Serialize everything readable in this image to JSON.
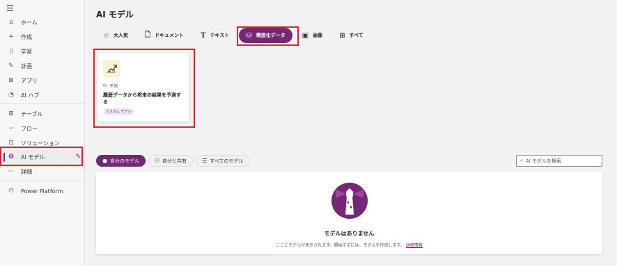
{
  "sidebar": {
    "items": [
      {
        "label": "ホーム",
        "icon": "home-icon"
      },
      {
        "label": "作成",
        "icon": "plus-icon"
      },
      {
        "label": "学習",
        "icon": "book-icon"
      },
      {
        "label": "計画",
        "icon": "plan-icon"
      },
      {
        "label": "アプリ",
        "icon": "apps-icon"
      },
      {
        "label": "AI ハブ",
        "icon": "ai-hub-icon"
      },
      {
        "label": "テーブル",
        "icon": "table-icon"
      },
      {
        "label": "フロー",
        "icon": "flow-icon"
      },
      {
        "label": "ソリューション",
        "icon": "solution-icon"
      },
      {
        "label": "AI モデル",
        "icon": "ai-model-icon"
      },
      {
        "label": "詳細",
        "icon": "more-icon"
      },
      {
        "label": "Power Platform",
        "icon": "power-platform-icon"
      }
    ],
    "active": "AI モデル"
  },
  "main": {
    "title": "AI モデル",
    "tabs": [
      {
        "label": "大人気",
        "icon": "star-icon"
      },
      {
        "label": "ドキュメント",
        "icon": "document-icon"
      },
      {
        "label": "テキスト",
        "icon": "text-icon"
      },
      {
        "label": "構造化データ",
        "icon": "database-icon",
        "selected": true
      },
      {
        "label": "画像",
        "icon": "image-icon"
      },
      {
        "label": "すべて",
        "icon": "grid-icon"
      }
    ],
    "card": {
      "type": "予測",
      "title": "履歴データから将来の結果を予測する",
      "badge": "カスタム モデル"
    },
    "filters": [
      {
        "label": "自分のモデル",
        "selected": true
      },
      {
        "label": "自分と共有"
      },
      {
        "label": "すべてのモデル"
      }
    ],
    "search_placeholder": "AI モデルを検索",
    "empty": {
      "title": "モデルはありません",
      "desc": "ここにモデルが表示されます。開始するには、モデルを作成します。",
      "link": "詳細情報"
    }
  },
  "colors": {
    "accent": "#742774",
    "highlight": "#d9262c"
  }
}
